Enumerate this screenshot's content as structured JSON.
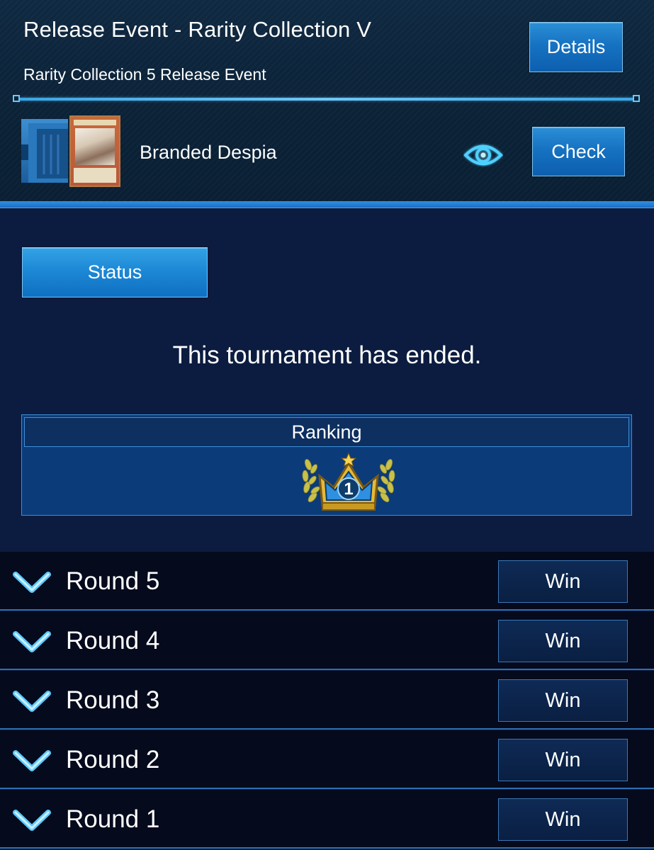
{
  "event": {
    "title": "Release Event - Rarity Collection V",
    "subtitle": "Rarity Collection 5 Release Event",
    "details_label": "Details"
  },
  "deck": {
    "name": "Branded Despia",
    "check_label": "Check"
  },
  "status_label": "Status",
  "message": "This tournament has ended.",
  "ranking": {
    "label": "Ranking",
    "rank": "1"
  },
  "rounds": [
    {
      "label": "Round 5",
      "result": "Win"
    },
    {
      "label": "Round 4",
      "result": "Win"
    },
    {
      "label": "Round 3",
      "result": "Win"
    },
    {
      "label": "Round 2",
      "result": "Win"
    },
    {
      "label": "Round 1",
      "result": "Win"
    }
  ],
  "colors": {
    "accent": "#1b86d4",
    "background": "#0c1c40",
    "row_background": "#050a1c",
    "gold": "#e5b93a"
  },
  "icons": {
    "deck": "deck-case-icon",
    "card": "card-thumbnail",
    "view": "eye-icon",
    "rank": "crown-icon",
    "expand": "chevron-down-icon"
  }
}
